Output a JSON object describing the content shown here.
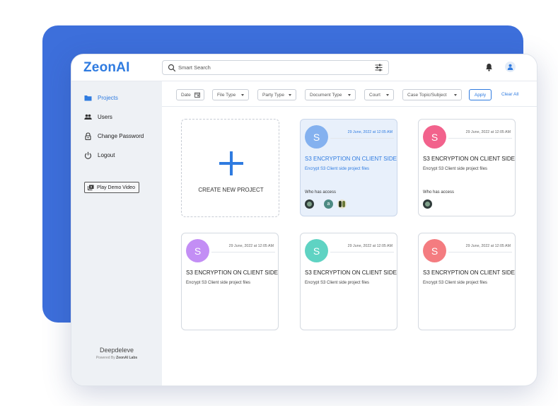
{
  "header": {
    "logo": "ZeonAI",
    "search_placeholder": "Smart Search"
  },
  "sidebar": {
    "items": [
      {
        "label": "Projects",
        "icon": "folder-icon",
        "active": true
      },
      {
        "label": "Users",
        "icon": "users-icon",
        "active": false
      },
      {
        "label": "Change Password",
        "icon": "lock-icon",
        "active": false
      },
      {
        "label": "Logout",
        "icon": "power-icon",
        "active": false
      }
    ],
    "demo_button": "Play Demo Video",
    "brand_name": "Deepdeleve",
    "powered_prefix": "Powered By ",
    "powered_brand": "ZeonAI Labs"
  },
  "filters": {
    "date": "Date",
    "file_type": "File Type",
    "party_type": "Party Type",
    "document_type": "Document Type",
    "court": "Court",
    "case_topic": "Case Topic/Subject",
    "apply": "Apply",
    "clear_all": "Clear All"
  },
  "create_card": {
    "label": "CREATE NEW PROJECT"
  },
  "projects": [
    {
      "letter": "S",
      "color": "#84b1ef",
      "date": "29 June, 2022 at 12:05 AM",
      "title": "S3 ENCRYPTION ON CLIENT SIDE",
      "description": "Encrypt S3 Client side project files",
      "access_label": "Who has access",
      "access_initial": "a"
    },
    {
      "letter": "S",
      "color": "#f2628c",
      "date": "29 June, 2022 at 12:05 AM",
      "title": "S3 ENCRYPTION ON CLIENT SIDE",
      "description": "Encrypt S3 Client side project files",
      "access_label": "Who has access"
    },
    {
      "letter": "S",
      "color": "#c38ef5",
      "date": "29 June, 2022 at 12:05 AM",
      "title": "S3 ENCRYPTION ON CLIENT SIDE",
      "description": "Encrypt S3 Client side project files"
    },
    {
      "letter": "S",
      "color": "#5fd3c3",
      "date": "29 June, 2022 at 12:05 AM",
      "title": "S3 ENCRYPTION ON CLIENT SIDE",
      "description": "Encrypt S3 Client side project files"
    },
    {
      "letter": "S",
      "color": "#f47c80",
      "date": "29 June, 2022 at 12:05 AM",
      "title": "S3 ENCRYPTION ON CLIENT SIDE",
      "description": "Encrypt S3 Client side project files"
    }
  ],
  "colors": {
    "accent": "#2f7be0",
    "backdrop": "#3d6fdb",
    "sidebar_bg": "#eef1f5"
  }
}
